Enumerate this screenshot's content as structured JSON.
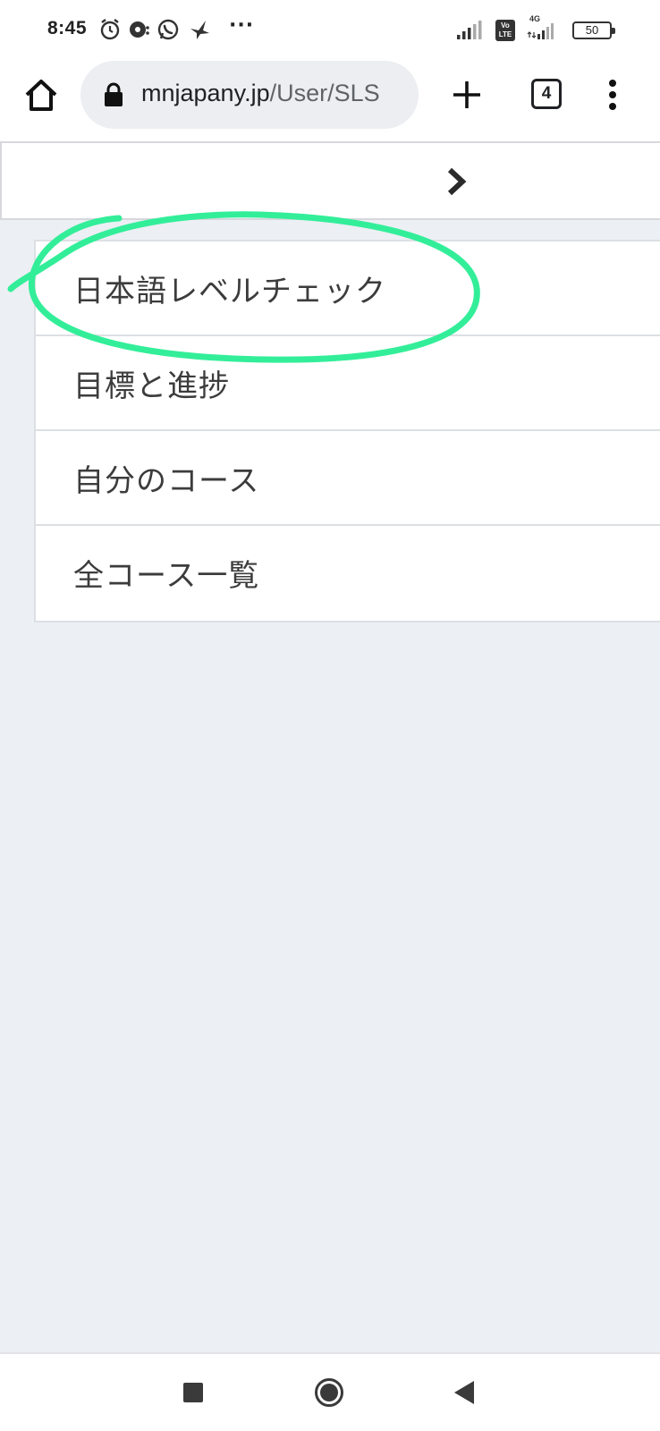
{
  "status_bar": {
    "time": "8:45",
    "more": "···",
    "network": "4G",
    "volte": "Vo LTE",
    "battery": "50",
    "icons": [
      "alarm-icon",
      "podcast-icon",
      "whatsapp-icon",
      "bird-icon",
      "signal-icon",
      "volte-icon",
      "signal-4g-icon",
      "battery-icon"
    ]
  },
  "browser": {
    "url_host": "mnjapany.jp",
    "url_path": "/User/SLS",
    "tab_count": "4",
    "icons": [
      "home-icon",
      "lock-icon",
      "plus-icon",
      "tabs-icon",
      "more-vert-icon"
    ]
  },
  "page": {
    "header_icon": "chevron-right-icon",
    "menu": [
      {
        "label": "日本語レベルチェック",
        "annotated": true
      },
      {
        "label": "目標と進捗",
        "annotated": false
      },
      {
        "label": "自分のコース",
        "annotated": false
      },
      {
        "label": "全コース一覧",
        "annotated": false
      }
    ],
    "annotation_color": "#33ee99"
  },
  "nav_bar": {
    "icons": [
      "recents-icon",
      "home-circle-icon",
      "back-icon"
    ]
  }
}
